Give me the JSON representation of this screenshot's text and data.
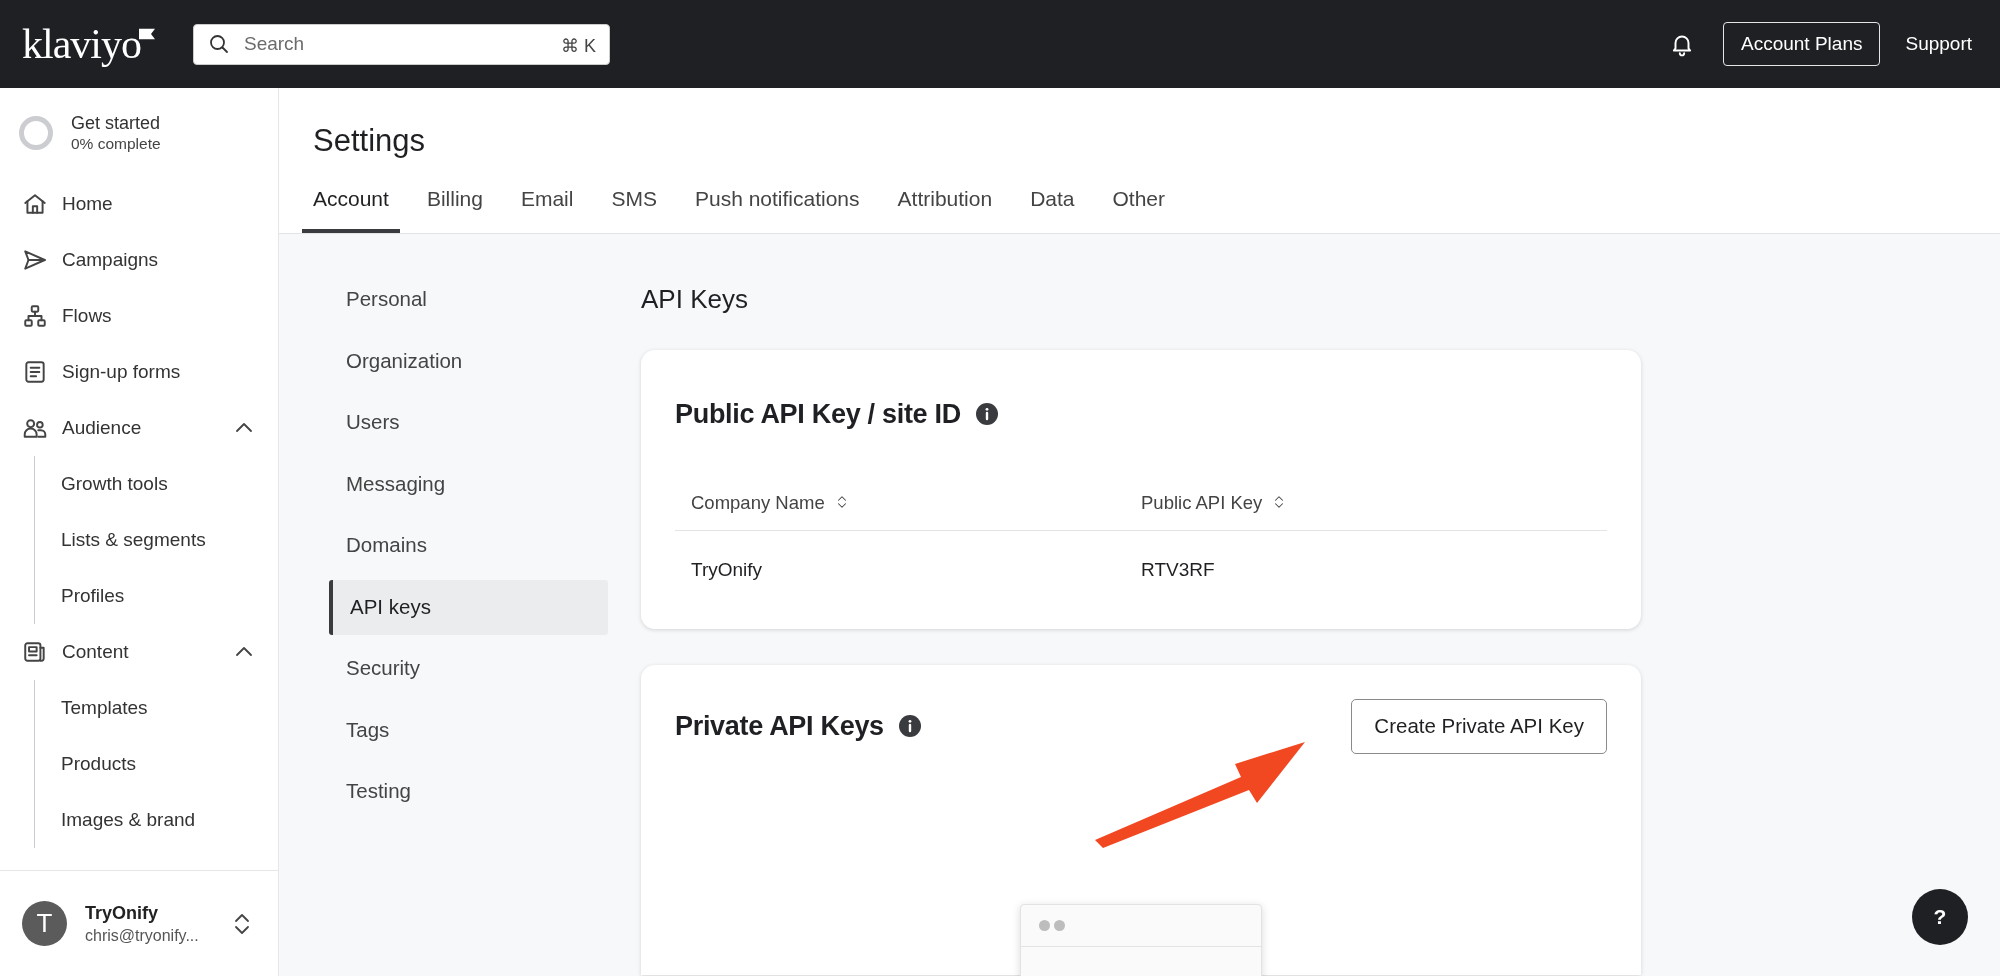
{
  "topbar": {
    "logo": "klaviyo",
    "search": {
      "placeholder": "Search",
      "shortcut": "⌘ K"
    },
    "buttons": [
      {
        "label": "Account Plans",
        "kind": "outline"
      },
      {
        "label": "Support",
        "kind": "text"
      }
    ]
  },
  "sidebar": {
    "progress": {
      "title": "Get started",
      "subtitle": "0% complete"
    },
    "items": [
      {
        "label": "Home"
      },
      {
        "label": "Campaigns"
      },
      {
        "label": "Flows"
      },
      {
        "label": "Sign-up forms"
      },
      {
        "label": "Audience",
        "expanded": true,
        "children": [
          {
            "label": "Growth tools"
          },
          {
            "label": "Lists & segments"
          },
          {
            "label": "Profiles"
          }
        ]
      },
      {
        "label": "Content",
        "expanded": true,
        "children": [
          {
            "label": "Templates"
          },
          {
            "label": "Products"
          },
          {
            "label": "Images & brand"
          }
        ]
      }
    ],
    "account": {
      "initial": "T",
      "name": "TryOnify",
      "email": "chris@tryonify..."
    }
  },
  "page": {
    "title": "Settings",
    "tabs": [
      {
        "label": "Account",
        "selected": true
      },
      {
        "label": "Billing",
        "selected": false
      },
      {
        "label": "Email",
        "selected": false
      },
      {
        "label": "SMS",
        "selected": false
      },
      {
        "label": "Push notifications",
        "selected": false
      },
      {
        "label": "Attribution",
        "selected": false
      },
      {
        "label": "Data",
        "selected": false
      },
      {
        "label": "Other",
        "selected": false
      }
    ],
    "subnav": [
      {
        "label": "Personal",
        "selected": false
      },
      {
        "label": "Organization",
        "selected": false
      },
      {
        "label": "Users",
        "selected": false
      },
      {
        "label": "Messaging",
        "selected": false
      },
      {
        "label": "Domains",
        "selected": false
      },
      {
        "label": "API keys",
        "selected": true
      },
      {
        "label": "Security",
        "selected": false
      },
      {
        "label": "Tags",
        "selected": false
      },
      {
        "label": "Testing",
        "selected": false
      }
    ],
    "heading": "API Keys",
    "public_card": {
      "title": "Public API Key / site ID",
      "columns": [
        "Company Name",
        "Public API Key"
      ],
      "rows": [
        [
          "TryOnify",
          "RTV3RF"
        ]
      ]
    },
    "private_card": {
      "title": "Private API Keys",
      "button": "Create Private API Key"
    }
  },
  "help_button": "?"
}
